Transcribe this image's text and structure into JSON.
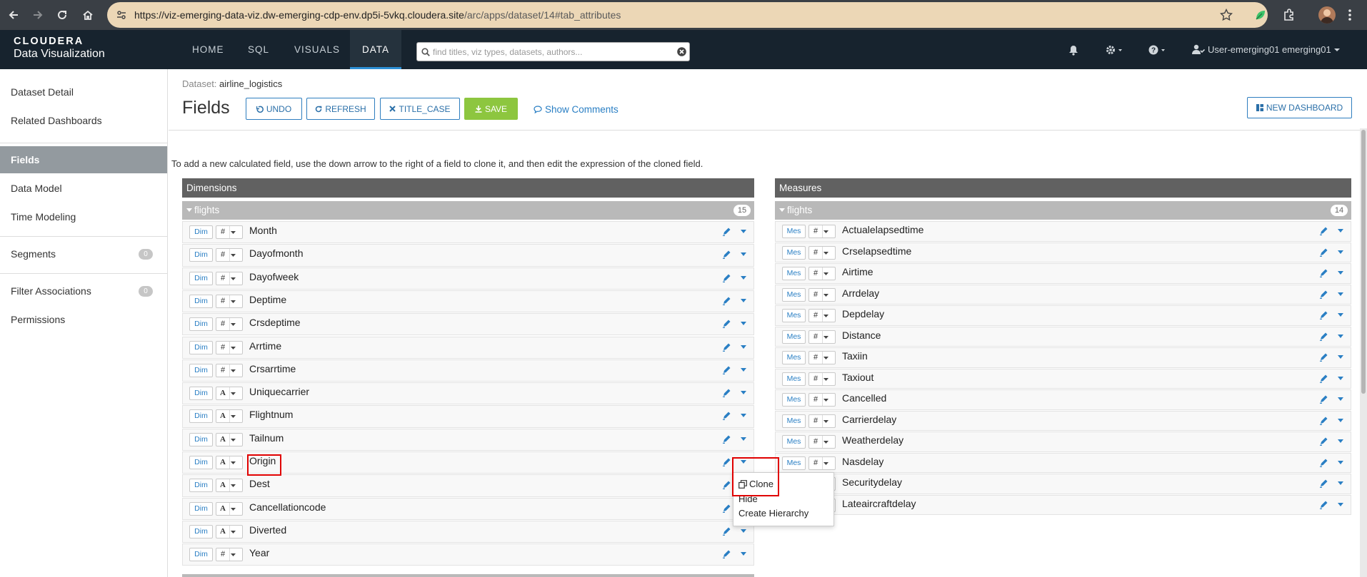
{
  "browser": {
    "url_host": "https://viz-emerging-data-viz.dw-emerging-cdp-env.dp5i-5vkq.cloudera.site",
    "url_path": "/arc/apps/dataset/14#tab_attributes"
  },
  "app": {
    "logo_line1": "CLOUDERA",
    "logo_line2": "Data Visualization",
    "nav": [
      "HOME",
      "SQL",
      "VISUALS",
      "DATA"
    ],
    "active_nav": "DATA",
    "search_placeholder": "find titles, viz types, datasets, authors...",
    "user_label": "User-emerging01 emerging01"
  },
  "sidebar": {
    "items": [
      {
        "label": "Dataset Detail"
      },
      {
        "label": "Related Dashboards"
      },
      {
        "label": "Fields"
      },
      {
        "label": "Data Model"
      },
      {
        "label": "Time Modeling"
      },
      {
        "label": "Segments",
        "count": "0"
      },
      {
        "label": "Filter Associations",
        "count": "0"
      },
      {
        "label": "Permissions"
      }
    ]
  },
  "page": {
    "dataset_label": "Dataset:",
    "dataset_name": "airline_logistics",
    "title": "Fields",
    "buttons": {
      "undo": "UNDO",
      "refresh": "REFRESH",
      "title_case": "TITLE_CASE",
      "save": "SAVE",
      "comments": "Show Comments",
      "new_dashboard": "NEW DASHBOARD"
    },
    "hint": "To add a new calculated field, use the down arrow to the right of a field to clone it, and then edit the expression of the cloned field."
  },
  "dimensions": {
    "title": "Dimensions",
    "group": "flights",
    "count": "15",
    "tag": "Dim",
    "fields": [
      {
        "name": "Month",
        "type": "#"
      },
      {
        "name": "Dayofmonth",
        "type": "#"
      },
      {
        "name": "Dayofweek",
        "type": "#"
      },
      {
        "name": "Deptime",
        "type": "#"
      },
      {
        "name": "Crsdeptime",
        "type": "#"
      },
      {
        "name": "Arrtime",
        "type": "#"
      },
      {
        "name": "Crsarrtime",
        "type": "#"
      },
      {
        "name": "Uniquecarrier",
        "type": "A"
      },
      {
        "name": "Flightnum",
        "type": "A"
      },
      {
        "name": "Tailnum",
        "type": "A"
      },
      {
        "name": "Origin",
        "type": "A"
      },
      {
        "name": "Dest",
        "type": "A"
      },
      {
        "name": "Cancellationcode",
        "type": "A"
      },
      {
        "name": "Diverted",
        "type": "A"
      },
      {
        "name": "Year",
        "type": "#"
      }
    ]
  },
  "measures": {
    "title": "Measures",
    "group": "flights",
    "count": "14",
    "tag": "Mes",
    "fields": [
      {
        "name": "Actualelapsedtime",
        "type": "#"
      },
      {
        "name": "Crselapsedtime",
        "type": "#"
      },
      {
        "name": "Airtime",
        "type": "#"
      },
      {
        "name": "Arrdelay",
        "type": "#"
      },
      {
        "name": "Depdelay",
        "type": "#"
      },
      {
        "name": "Distance",
        "type": "#"
      },
      {
        "name": "Taxiin",
        "type": "#"
      },
      {
        "name": "Taxiout",
        "type": "#"
      },
      {
        "name": "Cancelled",
        "type": "#"
      },
      {
        "name": "Carrierdelay",
        "type": "#"
      },
      {
        "name": "Weatherdelay",
        "type": "#"
      },
      {
        "name": "Nasdelay",
        "type": "#"
      },
      {
        "name": "Securitydelay",
        "type": "#"
      },
      {
        "name": "Lateaircraftdelay",
        "type": "#"
      }
    ]
  },
  "context_menu": {
    "items": [
      "Clone",
      "Hide",
      "Create Hierarchy"
    ]
  },
  "colors": {
    "accent": "#2e7ebf",
    "save": "#8dc63f",
    "highlight": "#e00000",
    "nav_bg": "#17232e"
  }
}
